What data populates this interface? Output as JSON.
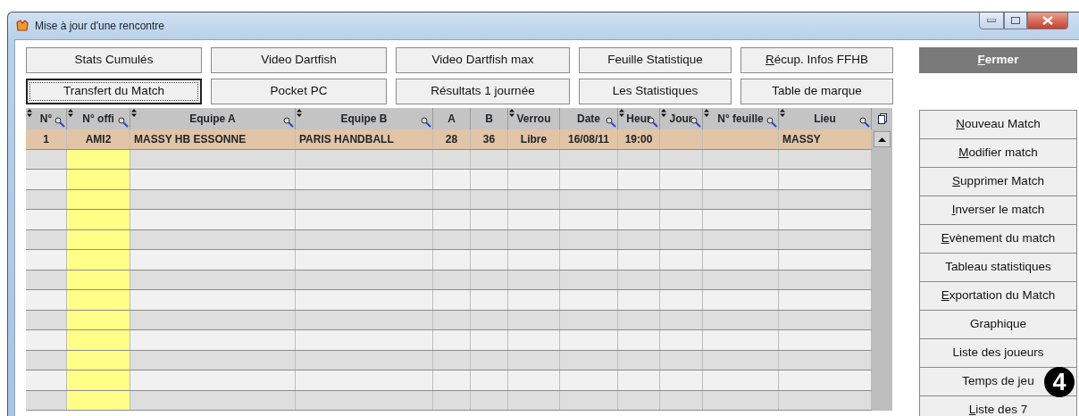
{
  "window": {
    "title": "Mise à jour d'une rencontre"
  },
  "top_buttons": [
    {
      "label": "Stats Cumulés",
      "focused": false
    },
    {
      "label": "Video Dartfish",
      "focused": false
    },
    {
      "label": "Video Dartfish max",
      "focused": false
    },
    {
      "label": "Feuille Statistique",
      "focused": false
    },
    {
      "hotkey": "R",
      "label": "écup. Infos FFHB",
      "focused": false
    },
    {
      "label": "Transfert du Match",
      "focused": true
    },
    {
      "label": "Pocket PC",
      "focused": false
    },
    {
      "label": "Résultats 1 journée",
      "focused": false
    },
    {
      "label": "Les Statistiques",
      "focused": false
    },
    {
      "label": "Table de marque",
      "focused": false
    }
  ],
  "close_button": {
    "hotkey": "F",
    "label": "ermer"
  },
  "table": {
    "columns": [
      {
        "label": "N°",
        "sortable": true,
        "searchable": true
      },
      {
        "label": "N° offi",
        "sortable": true,
        "searchable": true
      },
      {
        "label": "Equipe A",
        "sortable": true,
        "searchable": true
      },
      {
        "label": "Equipe B",
        "sortable": true,
        "searchable": true
      },
      {
        "label": "A",
        "sortable": false,
        "searchable": false
      },
      {
        "label": "B",
        "sortable": false,
        "searchable": false
      },
      {
        "label": "Verrou",
        "sortable": true,
        "searchable": false
      },
      {
        "label": "Date",
        "sortable": false,
        "searchable": true
      },
      {
        "label": "Heur",
        "sortable": true,
        "searchable": true
      },
      {
        "label": "Jour",
        "sortable": true,
        "searchable": true
      },
      {
        "label": "N° feuille",
        "sortable": true,
        "searchable": true
      },
      {
        "label": "Lieu",
        "sortable": true,
        "searchable": true
      }
    ],
    "rows": [
      {
        "selected": true,
        "cells": [
          "1",
          "AMI2",
          "MASSY HB ESSONNE",
          "PARIS HANDBALL",
          "28",
          "36",
          "Libre",
          "16/08/11",
          "19:00",
          "",
          "",
          "MASSY"
        ]
      }
    ]
  },
  "side_buttons": [
    {
      "hotkey": "N",
      "label": "ouveau Match"
    },
    {
      "hotkey": "M",
      "label": "odifier match"
    },
    {
      "hotkey": "S",
      "label": "upprimer Match"
    },
    {
      "hotkey": "I",
      "label": "nverser le match"
    },
    {
      "hotkey": "E",
      "label": "vènement du match"
    },
    {
      "label": "Tableau statistiques"
    },
    {
      "hotkey": "E",
      "label": "xportation du Match"
    },
    {
      "label": "Graphique"
    },
    {
      "label": "Liste des joueurs"
    },
    {
      "label": "Temps de jeu"
    },
    {
      "hotkey": "L",
      "label": "iste des 7"
    }
  ],
  "callout": "4"
}
